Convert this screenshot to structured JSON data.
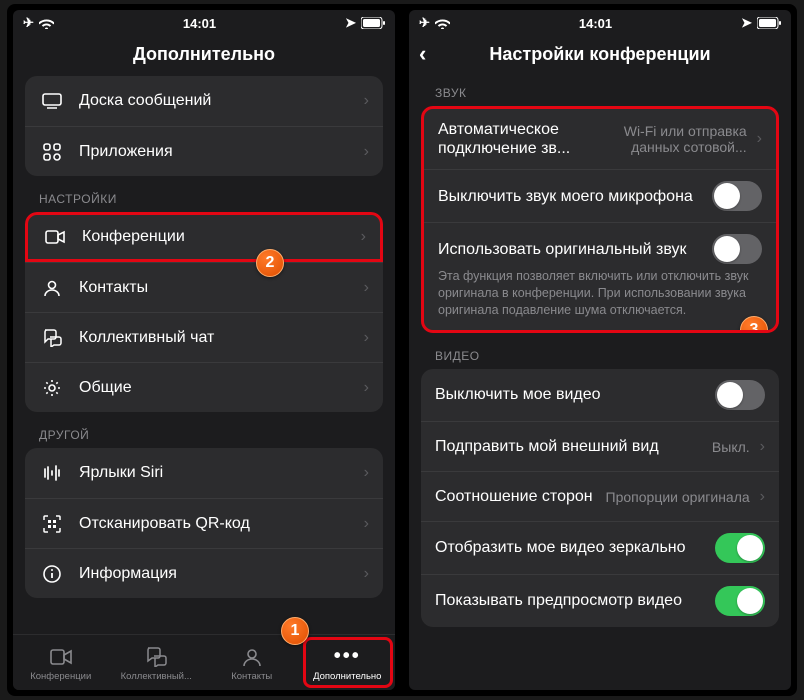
{
  "status": {
    "time": "14:01"
  },
  "left": {
    "title": "Дополнительно",
    "group1": [
      {
        "label": "Доска сообщений"
      },
      {
        "label": "Приложения"
      }
    ],
    "sh_settings": "НАСТРОЙКИ",
    "group2": [
      {
        "label": "Конференции"
      },
      {
        "label": "Контакты"
      },
      {
        "label": "Коллективный чат"
      },
      {
        "label": "Общие"
      }
    ],
    "sh_other": "ДРУГОЙ",
    "group3": [
      {
        "label": "Ярлыки Siri"
      },
      {
        "label": "Отсканировать QR-код"
      },
      {
        "label": "Информация"
      }
    ],
    "tabs": [
      "Конференции",
      "Коллективный...",
      "Контакты",
      "Дополнительно"
    ]
  },
  "right": {
    "title": "Настройки конференции",
    "sh_sound": "ЗВУК",
    "sound": {
      "auto_l": "Автоматическое подключение зв...",
      "auto_v": "Wi-Fi или отправка данных сотовой...",
      "mute": "Выключить звук моего микрофона",
      "orig": "Использовать оригинальный звук",
      "orig_desc": "Эта функция позволяет включить или отключить звук оригинала в конференции. При использовании звука оригинала подавление шума отключается."
    },
    "sh_video": "ВИДЕО",
    "video": {
      "off": "Выключить мое видео",
      "touch": "Подправить мой внешний вид",
      "touch_v": "Выкл.",
      "aspect_l": "Соотношение сторон",
      "aspect_v": "Пропорции оригинала",
      "mirror": "Отобразить мое видео зеркально",
      "preview": "Показывать предпросмотр видео"
    }
  },
  "badges": {
    "b1": "1",
    "b2": "2",
    "b3": "3"
  }
}
